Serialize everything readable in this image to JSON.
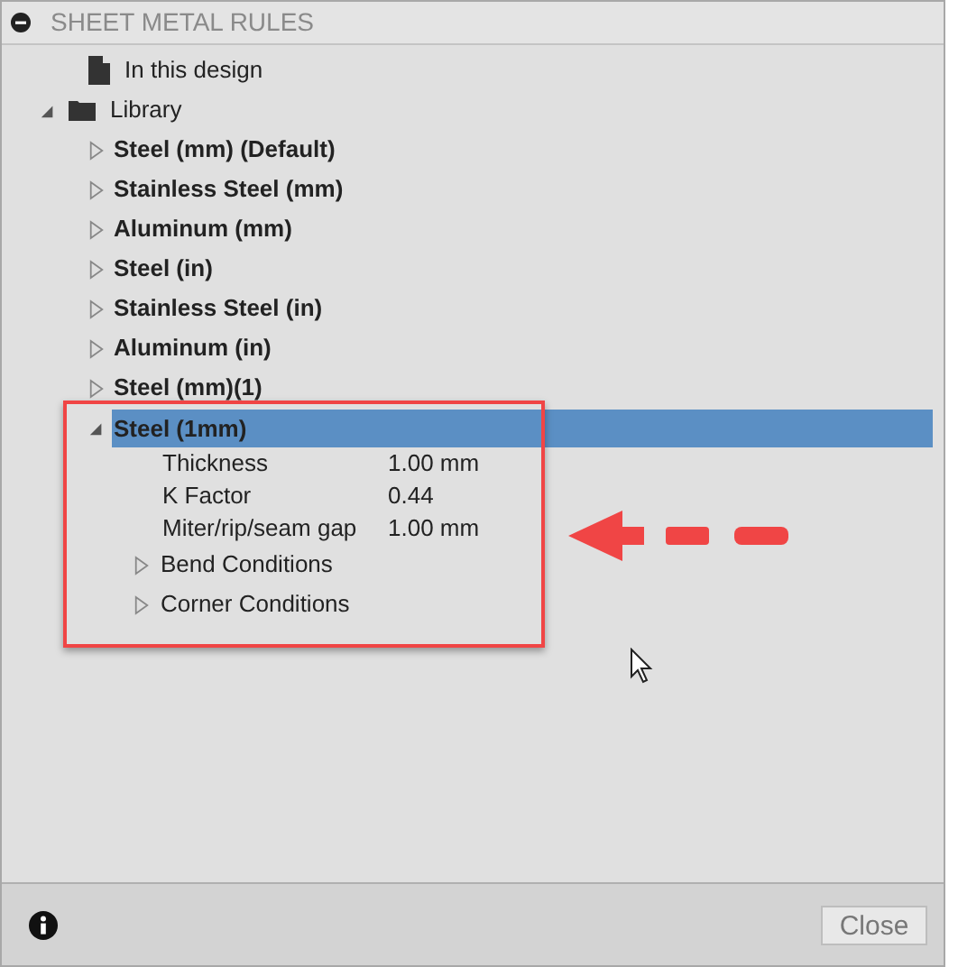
{
  "panel": {
    "title": "SHEET METAL RULES"
  },
  "tree": [
    {
      "label": "In this design",
      "kind": "document"
    },
    {
      "label": "Library",
      "kind": "folder",
      "expanded": true,
      "children": [
        {
          "label": "Steel (mm) (Default)",
          "kind": "rule",
          "expanded": false,
          "selected": false
        },
        {
          "label": "Stainless Steel (mm)",
          "kind": "rule",
          "expanded": false,
          "selected": false
        },
        {
          "label": "Aluminum (mm)",
          "kind": "rule",
          "expanded": false,
          "selected": false
        },
        {
          "label": "Steel (in)",
          "kind": "rule",
          "expanded": false,
          "selected": false
        },
        {
          "label": "Stainless Steel (in)",
          "kind": "rule",
          "expanded": false,
          "selected": false
        },
        {
          "label": "Aluminum (in)",
          "kind": "rule",
          "expanded": false,
          "selected": false
        },
        {
          "label": "Steel (mm)(1)",
          "kind": "rule",
          "expanded": false,
          "selected": false
        },
        {
          "label": "Steel (1mm)",
          "kind": "rule",
          "expanded": true,
          "selected": true,
          "children": [
            {
              "label": "Thickness",
              "kind": "property",
              "value": "1.00 mm"
            },
            {
              "label": "K Factor",
              "kind": "property",
              "value": "0.44"
            },
            {
              "label": "Miter/rip/seam gap",
              "kind": "property",
              "value": "1.00 mm"
            },
            {
              "label": "Bend Conditions",
              "kind": "group",
              "expanded": false
            },
            {
              "label": "Corner Conditions",
              "kind": "group",
              "expanded": false
            }
          ]
        }
      ]
    }
  ],
  "footer": {
    "button": "Close"
  }
}
